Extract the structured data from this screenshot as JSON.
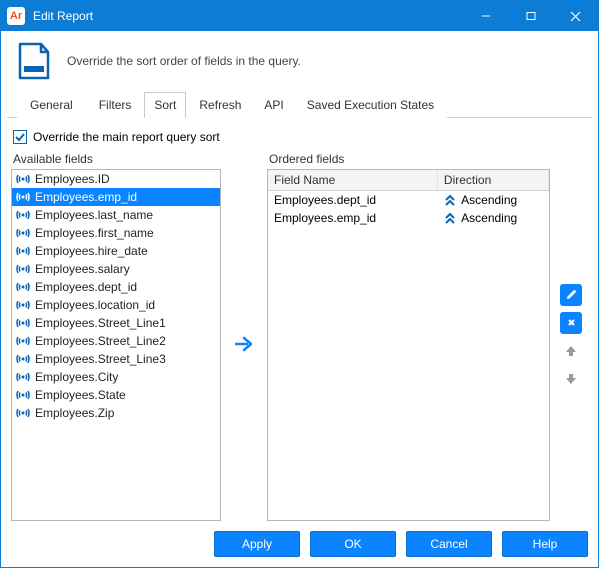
{
  "window": {
    "app_badge": "Ar",
    "title": "Edit Report"
  },
  "header": {
    "description": "Override the sort order of fields in the query."
  },
  "tabs": [
    "General",
    "Filters",
    "Sort",
    "Refresh",
    "API",
    "Saved Execution States"
  ],
  "active_tab": "Sort",
  "override_checkbox": {
    "label": "Override the main report query sort",
    "checked": true
  },
  "available_fields": {
    "label": "Available fields",
    "items": [
      "Employees.ID",
      "Employees.emp_id",
      "Employees.last_name",
      "Employees.first_name",
      "Employees.hire_date",
      "Employees.salary",
      "Employees.dept_id",
      "Employees.location_id",
      "Employees.Street_Line1",
      "Employees.Street_Line2",
      "Employees.Street_Line3",
      "Employees.City",
      "Employees.State",
      "Employees.Zip"
    ],
    "selected_index": 1
  },
  "ordered_fields": {
    "label": "Ordered fields",
    "columns": {
      "field": "Field Name",
      "direction": "Direction"
    },
    "rows": [
      {
        "name": "Employees.dept_id",
        "direction": "Ascending"
      },
      {
        "name": "Employees.emp_id",
        "direction": "Ascending"
      }
    ]
  },
  "footer": {
    "apply": "Apply",
    "ok": "OK",
    "cancel": "Cancel",
    "help": "Help"
  }
}
